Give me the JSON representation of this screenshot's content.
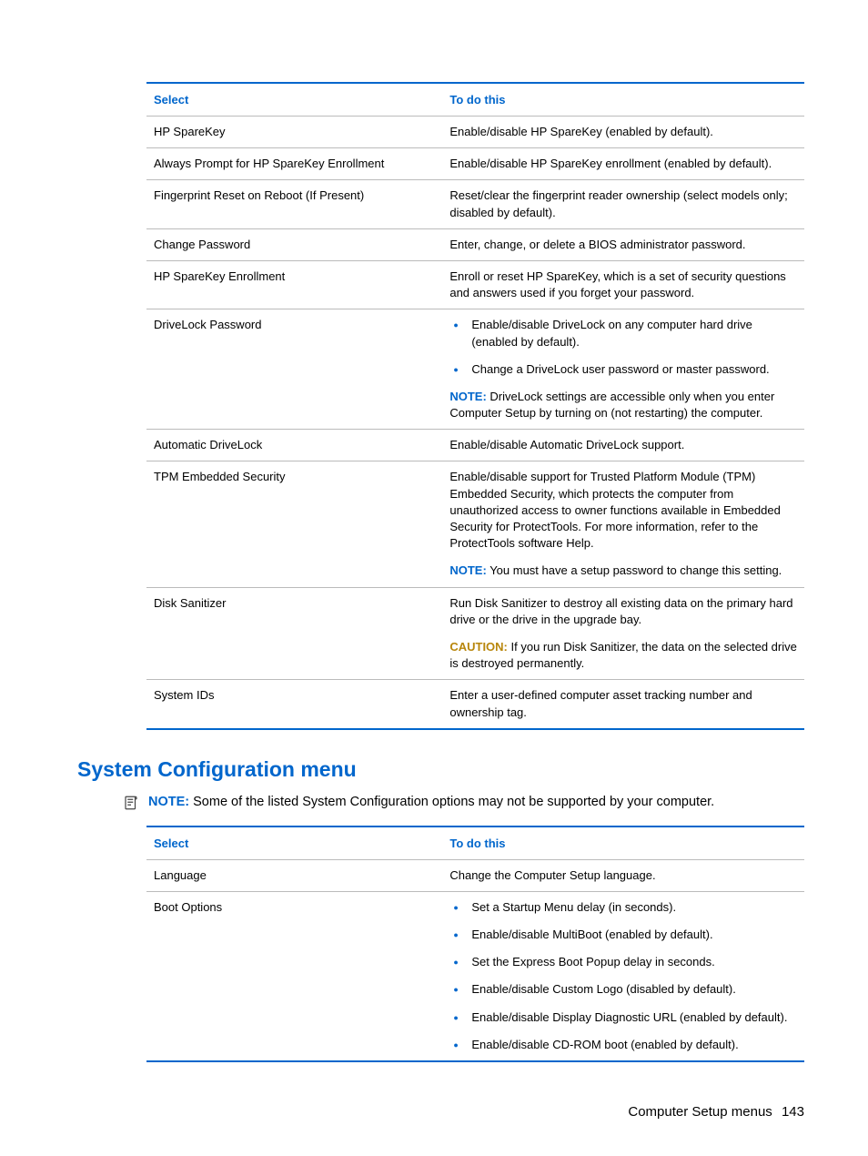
{
  "table1": {
    "header": {
      "col1": "Select",
      "col2": "To do this"
    },
    "rows": [
      {
        "select": "HP SpareKey",
        "action_text": "Enable/disable HP SpareKey (enabled by default)."
      },
      {
        "select": "Always Prompt for HP SpareKey Enrollment",
        "action_text": "Enable/disable HP SpareKey enrollment (enabled by default)."
      },
      {
        "select": "Fingerprint Reset on Reboot (If Present)",
        "action_text": "Reset/clear the fingerprint reader ownership (select models only; disabled by default)."
      },
      {
        "select": "Change Password",
        "action_text": "Enter, change, or delete a BIOS administrator password."
      },
      {
        "select": "HP SpareKey Enrollment",
        "action_text": "Enroll or reset HP SpareKey, which is a set of security questions and answers used if you forget your password."
      },
      {
        "select": "DriveLock Password",
        "bullets": [
          "Enable/disable DriveLock on any computer hard drive (enabled by default).",
          "Change a DriveLock user password or master password."
        ],
        "note_label": "NOTE:",
        "note_text": "DriveLock settings are accessible only when you enter Computer Setup by turning on (not restarting) the computer."
      },
      {
        "select": "Automatic DriveLock",
        "action_text": "Enable/disable Automatic DriveLock support."
      },
      {
        "select": "TPM Embedded Security",
        "action_text": "Enable/disable support for Trusted Platform Module (TPM) Embedded Security, which protects the computer from unauthorized access to owner functions available in Embedded Security for ProtectTools. For more information, refer to the ProtectTools software Help.",
        "note_label": "NOTE:",
        "note_text": "You must have a setup password to change this setting."
      },
      {
        "select": "Disk Sanitizer",
        "action_text": "Run Disk Sanitizer to destroy all existing data on the primary hard drive or the drive in the upgrade bay.",
        "caution_label": "CAUTION:",
        "caution_text": "If you run Disk Sanitizer, the data on the selected drive is destroyed permanently."
      },
      {
        "select": "System IDs",
        "action_text": "Enter a user-defined computer asset tracking number and ownership tag."
      }
    ]
  },
  "section_heading": "System Configuration menu",
  "section_note": {
    "label": "NOTE:",
    "text": "Some of the listed System Configuration options may not be supported by your computer."
  },
  "table2": {
    "header": {
      "col1": "Select",
      "col2": "To do this"
    },
    "rows": [
      {
        "select": "Language",
        "action_text": "Change the Computer Setup language."
      },
      {
        "select": "Boot Options",
        "bullets": [
          "Set a Startup Menu delay (in seconds).",
          "Enable/disable MultiBoot (enabled by default).",
          "Set the Express Boot Popup delay in seconds.",
          "Enable/disable Custom Logo (disabled by default).",
          "Enable/disable Display Diagnostic URL (enabled by default).",
          "Enable/disable CD-ROM boot (enabled by default)."
        ]
      }
    ]
  },
  "footer": {
    "title": "Computer Setup menus",
    "page": "143"
  }
}
